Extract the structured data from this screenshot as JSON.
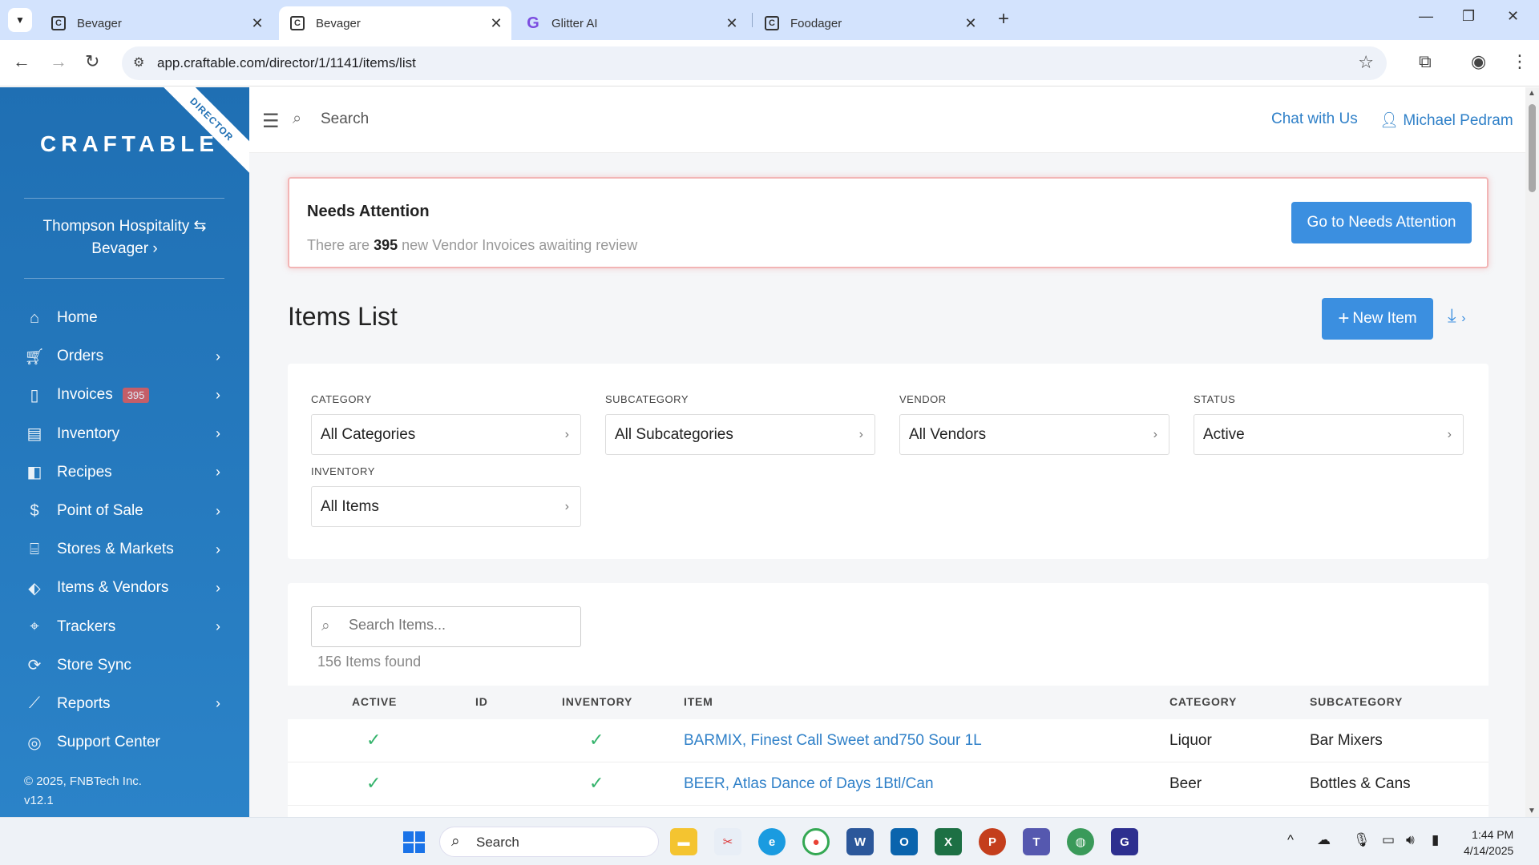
{
  "browser": {
    "tabs": [
      {
        "title": "Bevager",
        "favicon": "C"
      },
      {
        "title": "Bevager",
        "favicon": "C"
      },
      {
        "title": "Glitter AI",
        "favicon": "G"
      },
      {
        "title": "Foodager",
        "favicon": "C"
      }
    ],
    "url": "app.craftable.com/director/1/1141/items/list"
  },
  "sidebar": {
    "ribbon": "DIRECTOR",
    "logo": "CRAFTABLE",
    "org_name": "Thompson Hospitality",
    "org_sub": "Bevager",
    "items": [
      {
        "label": "Home",
        "icon": "home-icon"
      },
      {
        "label": "Orders",
        "icon": "cart-icon"
      },
      {
        "label": "Invoices",
        "icon": "clipboard-icon",
        "badge": "395"
      },
      {
        "label": "Inventory",
        "icon": "box-icon"
      },
      {
        "label": "Recipes",
        "icon": "mixer-icon"
      },
      {
        "label": "Point of Sale",
        "icon": "dollar-icon"
      },
      {
        "label": "Stores & Markets",
        "icon": "store-icon"
      },
      {
        "label": "Items & Vendors",
        "icon": "tag-icon"
      },
      {
        "label": "Trackers",
        "icon": "pin-icon"
      },
      {
        "label": "Store Sync",
        "icon": "sync-icon"
      },
      {
        "label": "Reports",
        "icon": "chart-icon"
      },
      {
        "label": "Support Center",
        "icon": "lifebuoy-icon"
      }
    ],
    "copyright": "© 2025, FNBTech Inc.",
    "version": "v12.1"
  },
  "header": {
    "search_placeholder": "Search",
    "chat": "Chat with Us",
    "user": "Michael Pedram"
  },
  "attention": {
    "title": "Needs Attention",
    "text_before": "There are",
    "count": "395",
    "text_after": "new Vendor Invoices awaiting review",
    "button": "Go to Needs Attention"
  },
  "page": {
    "title": "Items List",
    "new_item": "New Item"
  },
  "filters": {
    "category_label": "CATEGORY",
    "category_value": "All Categories",
    "subcategory_label": "SUBCATEGORY",
    "subcategory_value": "All Subcategories",
    "vendor_label": "VENDOR",
    "vendor_value": "All Vendors",
    "status_label": "STATUS",
    "status_value": "Active",
    "inventory_label": "INVENTORY",
    "inventory_value": "All Items"
  },
  "list": {
    "search_placeholder": "Search Items...",
    "found": "156 Items found",
    "columns": [
      "ACTIVE",
      "ID",
      "INVENTORY",
      "ITEM",
      "CATEGORY",
      "SUBCATEGORY"
    ],
    "rows": [
      {
        "active": true,
        "id": "",
        "inventory": true,
        "item": "BARMIX, Finest Call Sweet and750 Sour 1L",
        "category": "Liquor",
        "subcategory": "Bar Mixers"
      },
      {
        "active": true,
        "id": "",
        "inventory": true,
        "item": "BEER, Atlas Dance of Days 1Btl/Can",
        "category": "Beer",
        "subcategory": "Bottles & Cans"
      }
    ]
  },
  "taskbar": {
    "search": "Search",
    "time": "1:44 PM",
    "date": "4/14/2025"
  }
}
